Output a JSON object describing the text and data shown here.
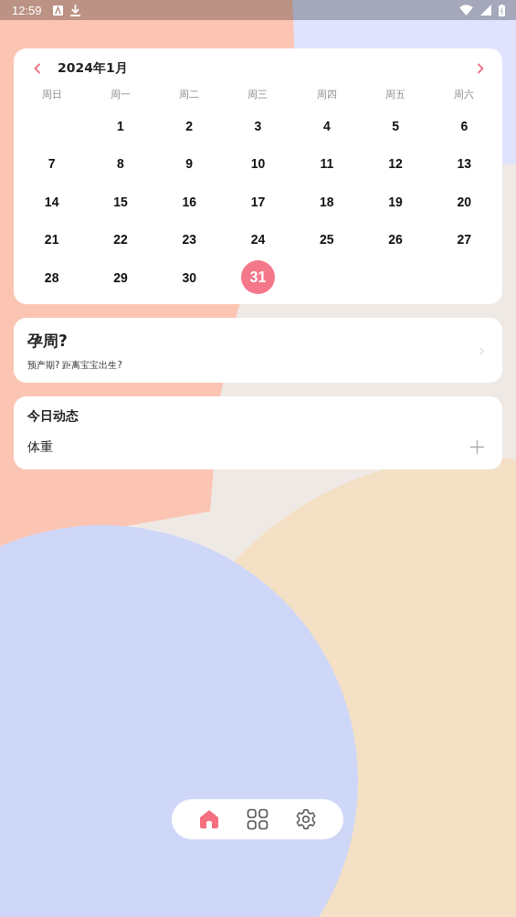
{
  "status_bar": {
    "time": "12:59"
  },
  "calendar": {
    "title": "2024年1月",
    "weekdays": [
      "周日",
      "周一",
      "周二",
      "周三",
      "周四",
      "周五",
      "周六"
    ],
    "weeks": [
      [
        {
          "day": "1",
          "selected": false
        },
        {
          "day": "2",
          "selected": false
        },
        {
          "day": "3",
          "selected": false
        },
        {
          "day": "4",
          "selected": false
        },
        {
          "day": "5",
          "selected": false
        },
        {
          "day": "6",
          "selected": false
        }
      ],
      [
        {
          "day": "7",
          "selected": false
        },
        {
          "day": "8",
          "selected": false
        },
        {
          "day": "9",
          "selected": false
        },
        {
          "day": "10",
          "selected": false
        },
        {
          "day": "11",
          "selected": false
        },
        {
          "day": "12",
          "selected": false
        },
        {
          "day": "13",
          "selected": false
        }
      ],
      [
        {
          "day": "14",
          "selected": false
        },
        {
          "day": "15",
          "selected": false
        },
        {
          "day": "16",
          "selected": false
        },
        {
          "day": "17",
          "selected": false
        },
        {
          "day": "18",
          "selected": false
        },
        {
          "day": "19",
          "selected": false
        },
        {
          "day": "20",
          "selected": false
        }
      ],
      [
        {
          "day": "21",
          "selected": false
        },
        {
          "day": "22",
          "selected": false
        },
        {
          "day": "23",
          "selected": false
        },
        {
          "day": "24",
          "selected": false
        },
        {
          "day": "25",
          "selected": false
        },
        {
          "day": "26",
          "selected": false
        },
        {
          "day": "27",
          "selected": false
        }
      ],
      [
        {
          "day": "28",
          "selected": false
        },
        {
          "day": "29",
          "selected": false
        },
        {
          "day": "30",
          "selected": false
        },
        {
          "day": "31",
          "selected": true
        }
      ]
    ]
  },
  "pregnancy_card": {
    "title": "孕周?",
    "subtitle": "预产期? 距离宝宝出生?"
  },
  "today_card": {
    "title": "今日动态",
    "items": [
      {
        "label": "体重"
      }
    ]
  },
  "bottom_nav": [
    {
      "kind": "home",
      "selected": true
    },
    {
      "kind": "apps",
      "selected": false
    },
    {
      "kind": "settings",
      "selected": false
    }
  ]
}
